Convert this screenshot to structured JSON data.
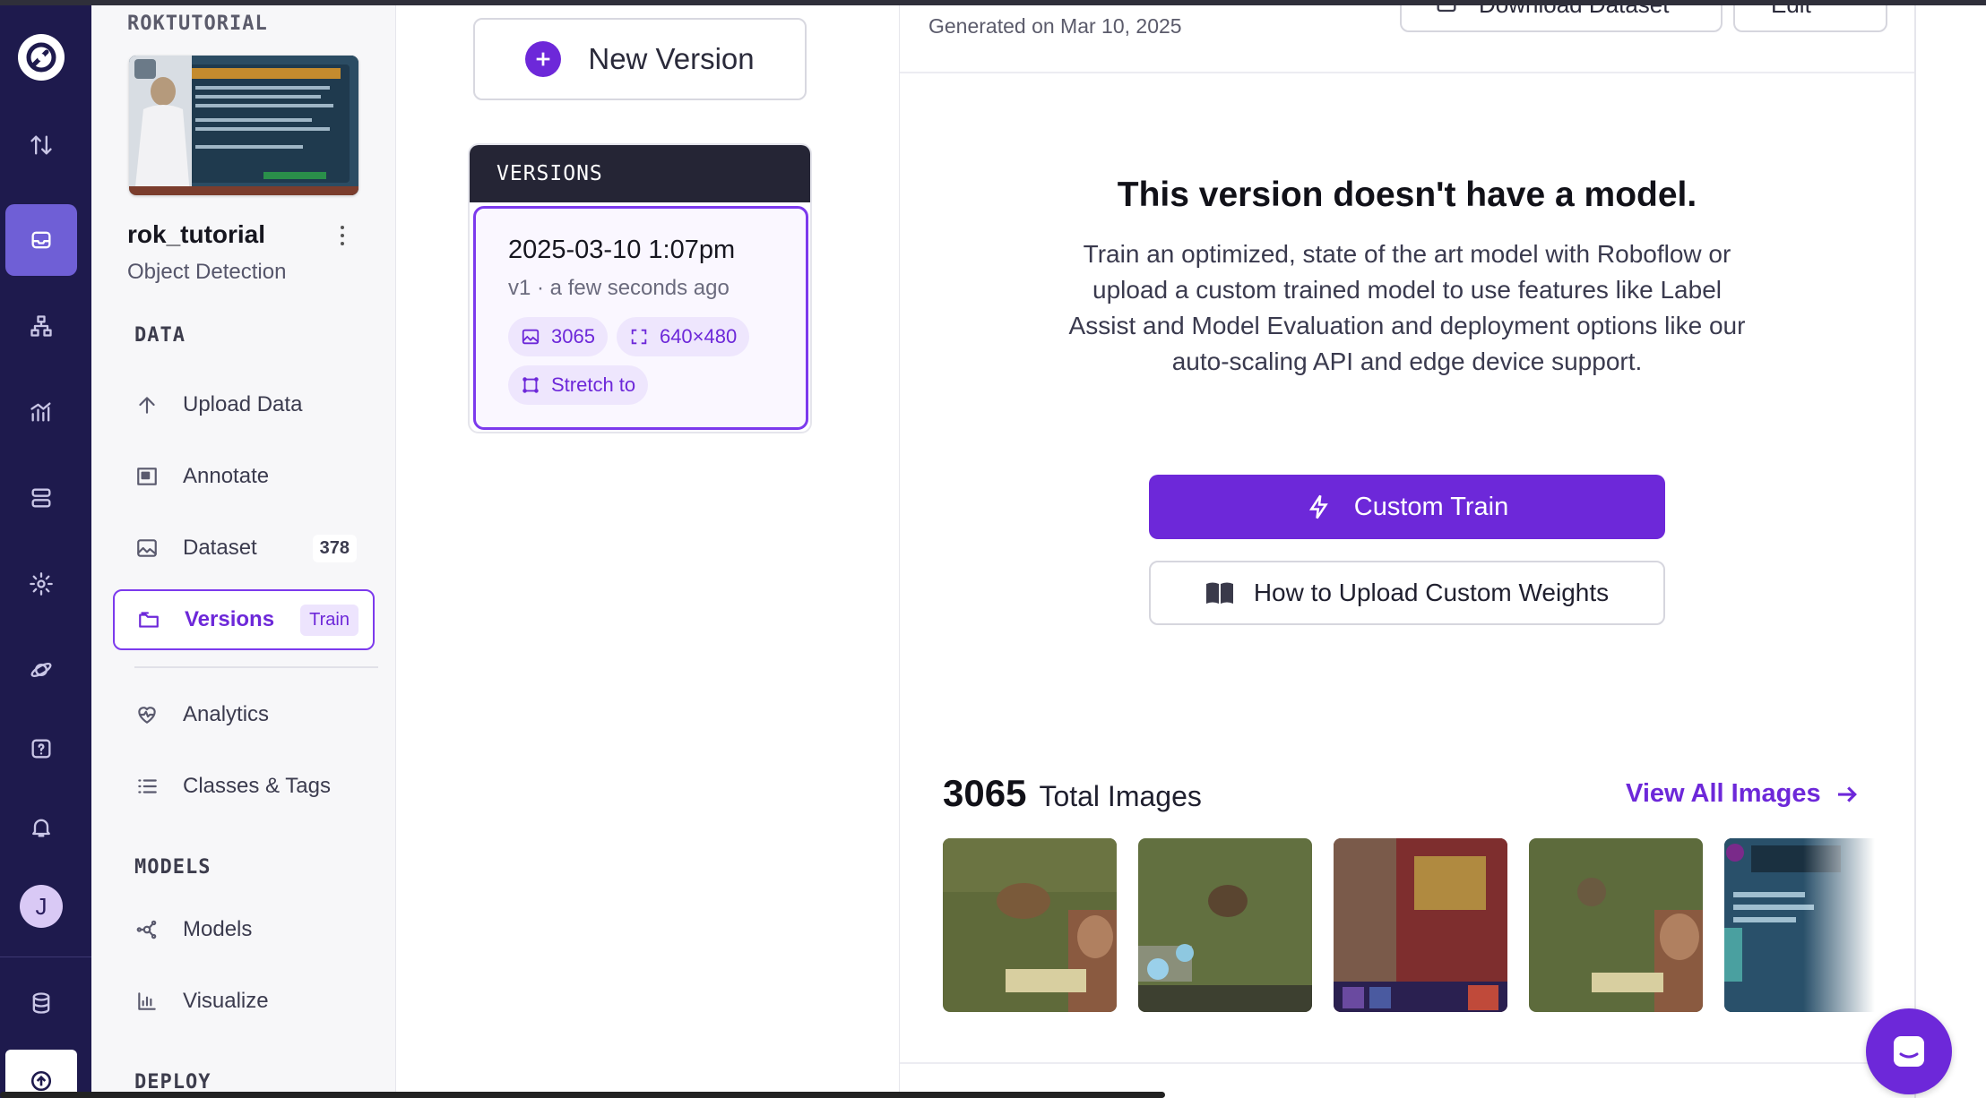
{
  "workspace": {
    "name": "ROKTUTORIAL"
  },
  "project": {
    "name": "rok_tutorial",
    "type": "Object Detection"
  },
  "rail": {
    "items": [
      "logo-icon",
      "sort-icon",
      "inbox-icon",
      "hierarchy-icon",
      "chart-icon",
      "server-icon",
      "gear-icon",
      "planet-icon",
      "help-icon",
      "bell-icon"
    ],
    "avatar_initial": "J"
  },
  "sidebar": {
    "data_header": "DATA",
    "models_header": "MODELS",
    "deploy_header": "DEPLOY",
    "items": [
      {
        "label": "Upload Data",
        "icon": "upload-icon"
      },
      {
        "label": "Annotate",
        "icon": "annotate-icon"
      },
      {
        "label": "Dataset",
        "icon": "image-icon",
        "count": "378"
      },
      {
        "label": "Versions",
        "icon": "folder-icon",
        "badge": "Train"
      },
      {
        "label": "Analytics",
        "icon": "heart-pulse-icon"
      },
      {
        "label": "Classes & Tags",
        "icon": "list-icon"
      }
    ],
    "model_items": [
      {
        "label": "Models",
        "icon": "graph-icon"
      },
      {
        "label": "Visualize",
        "icon": "bar-chart-icon"
      }
    ]
  },
  "versions": {
    "new_version_label": "New Version",
    "header": "VERSIONS",
    "card": {
      "date": "2025-03-10 1:07pm",
      "subtitle": "v1 · a few seconds ago",
      "images": "3065",
      "size": "640×480",
      "resize": "Stretch to"
    }
  },
  "main": {
    "generated_on": "Generated on Mar 10, 2025",
    "download_label": "Download Dataset",
    "edit_label": "Edit",
    "no_model_title": "This version doesn't have a model.",
    "no_model_desc": "Train an optimized, state of the art model with Roboflow or upload a custom trained model to use features like Label Assist and Model Evaluation and deployment options like our auto-scaling API and edge device support.",
    "custom_train_label": "Custom Train",
    "upload_weights_label": "How to Upload Custom Weights",
    "total_images_count": "3065",
    "total_images_label": "Total Images",
    "view_all_label": "View All Images"
  },
  "colors": {
    "accent": "#6d28d9",
    "rail_bg": "#1e1a4d",
    "versions_header_bg": "#252535"
  }
}
